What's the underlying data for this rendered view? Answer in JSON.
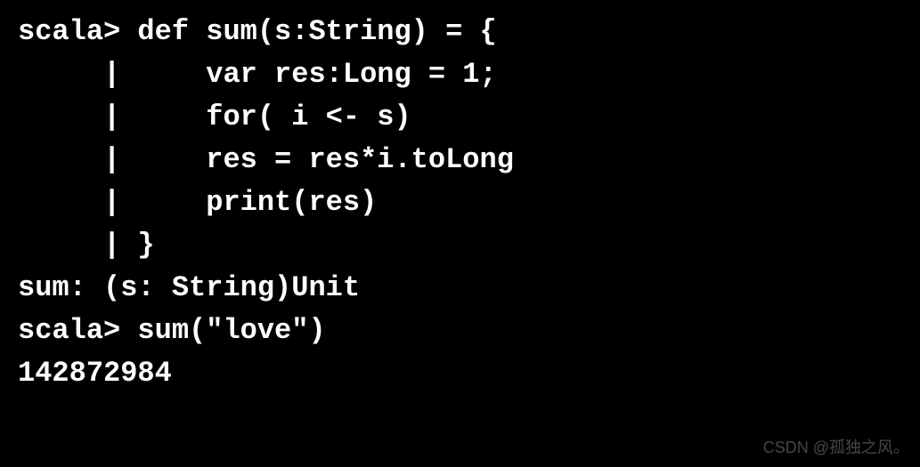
{
  "terminal": {
    "lines": [
      "scala> def sum(s:String) = {",
      "     |     var res:Long = 1;",
      "     |     for( i <- s)",
      "     |     res = res*i.toLong",
      "     |     print(res)",
      "     | }",
      "sum: (s: String)Unit",
      "",
      "scala> sum(\"love\")",
      "142872984"
    ]
  },
  "watermark": "CSDN @孤独之风。"
}
